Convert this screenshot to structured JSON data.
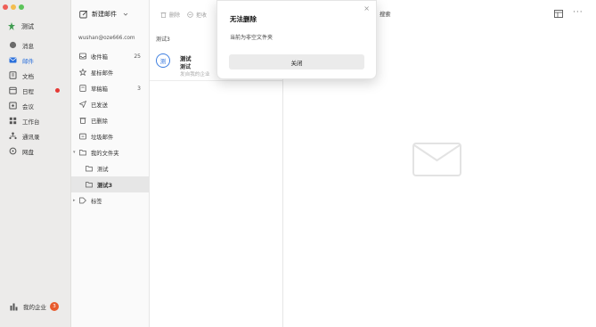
{
  "window": {
    "traffic_colors": [
      "#ee5e56",
      "#f4bd4f",
      "#5cc45a"
    ]
  },
  "sidebar": {
    "org_name": "测试",
    "items": [
      {
        "icon": "message-icon",
        "label": "消息",
        "active": false
      },
      {
        "icon": "mail-icon",
        "label": "邮件",
        "active": true
      },
      {
        "icon": "doc-icon",
        "label": "文档",
        "active": false
      },
      {
        "icon": "calendar-icon",
        "label": "日程",
        "active": false,
        "dot": true
      },
      {
        "icon": "meeting-icon",
        "label": "会议",
        "active": false
      },
      {
        "icon": "apps-icon",
        "label": "工作台",
        "active": false
      },
      {
        "icon": "contacts-icon",
        "label": "通讯录",
        "active": false
      },
      {
        "icon": "disk-icon",
        "label": "网盘",
        "active": false
      }
    ],
    "bottom": {
      "label": "我的企业",
      "badge": "3"
    },
    "accent": "#2a6fdb",
    "dot_color": "#e53935",
    "badge_color": "#e85a2c"
  },
  "folder_panel": {
    "compose_label": "新建邮件",
    "account": "wushan@oze666.com",
    "folders": [
      {
        "icon": "inbox-icon",
        "label": "收件箱",
        "count": "25"
      },
      {
        "icon": "star-icon",
        "label": "星标邮件",
        "count": ""
      },
      {
        "icon": "draft-icon",
        "label": "草稿箱",
        "count": "3"
      },
      {
        "icon": "send-icon",
        "label": "已发送",
        "count": ""
      },
      {
        "icon": "trash-icon",
        "label": "已删除",
        "count": ""
      },
      {
        "icon": "spam-icon",
        "label": "垃圾邮件",
        "count": ""
      },
      {
        "icon": "folder-icon",
        "label": "我的文件夹",
        "count": "",
        "caret": true
      },
      {
        "icon": "folder-icon",
        "label": "测试",
        "count": "",
        "sub": true
      },
      {
        "icon": "folder-icon",
        "label": "测试3",
        "count": "",
        "sub": true,
        "selected": true
      },
      {
        "icon": "tag-icon",
        "label": "标签",
        "count": "",
        "caret": true
      }
    ]
  },
  "toolbar": {
    "delete_label": "删除",
    "reject_label": "拒收",
    "search_label": "搜索"
  },
  "mail_list": {
    "title": "测试3",
    "items": [
      {
        "avatar": "测",
        "sender": "测试",
        "subject": "测试",
        "preview": "发自我的企业"
      }
    ]
  },
  "dialog": {
    "title": "无法删除",
    "message": "当前为非空文件夹",
    "button": "关闭"
  }
}
